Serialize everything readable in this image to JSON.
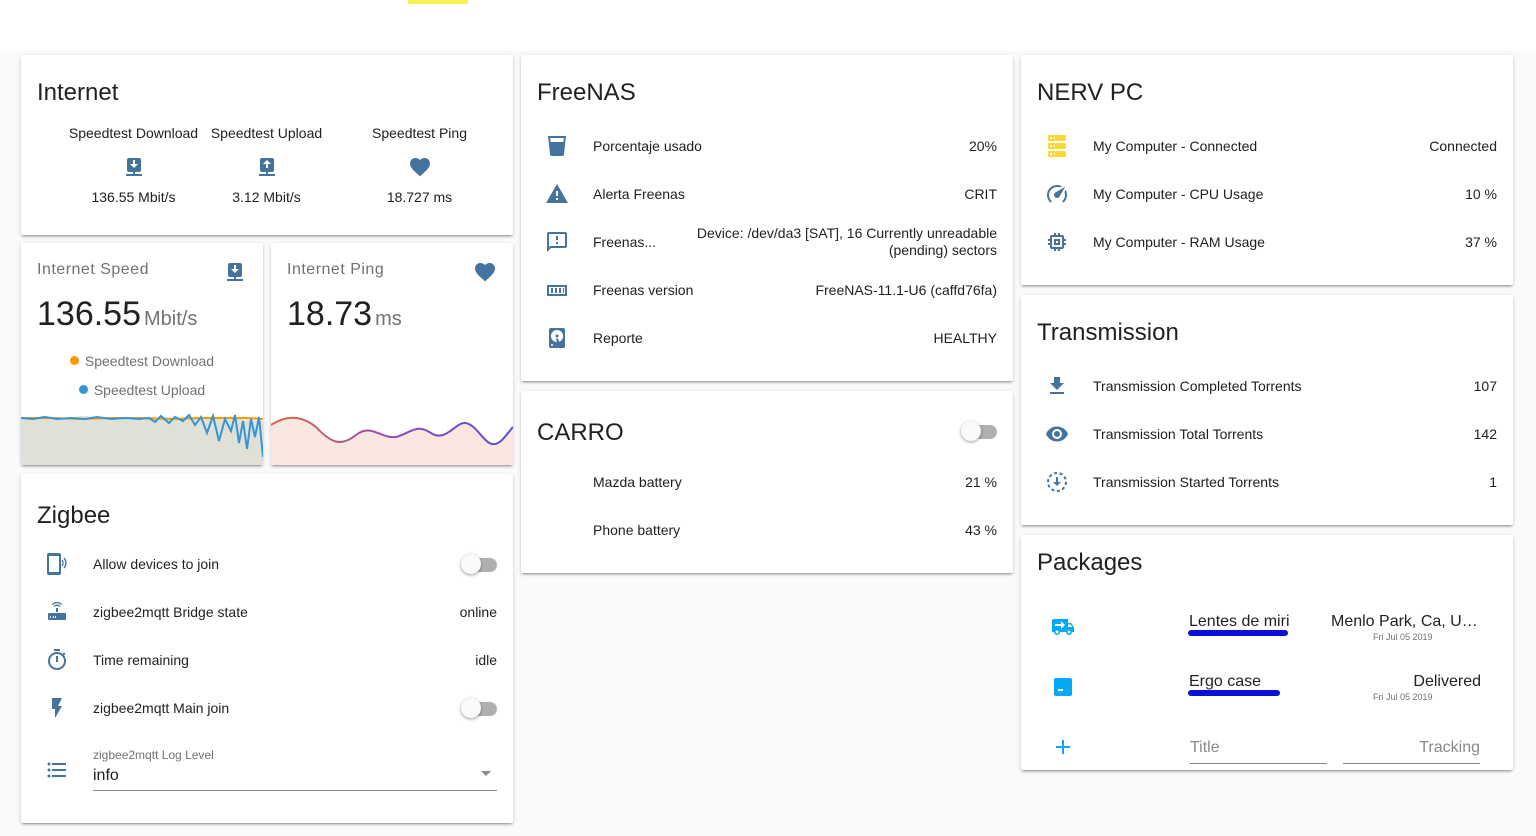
{
  "internet": {
    "title": "Internet",
    "entities": [
      {
        "name": "Speedtest Download",
        "icon": "download-network-icon",
        "value": "136.55 Mbit/s"
      },
      {
        "name": "Speedtest Upload",
        "icon": "upload-network-icon",
        "value": "3.12 Mbit/s"
      },
      {
        "name": "Speedtest Ping",
        "icon": "heart-icon",
        "value": "18.727 ms"
      }
    ]
  },
  "internet_speed": {
    "name": "Internet Speed",
    "value": "136.55",
    "unit": "Mbit/s",
    "icon": "download-network-icon",
    "legend": [
      {
        "name": "Speedtest Download",
        "color": "#ff9800"
      },
      {
        "name": "Speedtest Upload",
        "color": "#3295d8"
      }
    ]
  },
  "internet_ping": {
    "name": "Internet Ping",
    "value": "18.73",
    "unit": "ms",
    "icon": "heart-icon"
  },
  "freenas": {
    "title": "FreeNAS",
    "rows": [
      {
        "icon": "cup-icon",
        "name": "Porcentaje usado",
        "value": "20%"
      },
      {
        "icon": "alert-icon",
        "name": "Alerta Freenas",
        "value": "CRIT"
      },
      {
        "icon": "message-alert-icon",
        "name": "Freenas...",
        "value_line1": "Device: /dev/da3 [SAT], 16 Currently unreadable",
        "value_line2": "(pending) sectors"
      },
      {
        "icon": "memory-icon",
        "name": "Freenas version",
        "value": "FreeNAS-11.1-U6 (caffd76fa)"
      },
      {
        "icon": "harddisk-icon",
        "name": "Reporte",
        "value": "HEALTHY"
      }
    ]
  },
  "carro": {
    "title": "CARRO",
    "toggle_on": false,
    "rows": [
      {
        "name": "Mazda battery",
        "value": "21 %"
      },
      {
        "name": "Phone battery",
        "value": "43 %"
      }
    ]
  },
  "zigbee": {
    "title": "Zigbee",
    "rows": [
      {
        "icon": "cellphone-wireless-icon",
        "name": "Allow devices to join",
        "toggle_on": false
      },
      {
        "icon": "router-wireless-icon",
        "name": "zigbee2mqtt Bridge state",
        "value": "online"
      },
      {
        "icon": "timer-icon",
        "name": "Time remaining",
        "value": "idle"
      },
      {
        "icon": "flash-icon",
        "name": "zigbee2mqtt Main join",
        "toggle_on": false
      }
    ],
    "select": {
      "icon": "format-list-bulleted-icon",
      "label": "zigbee2mqtt Log Level",
      "value": "info"
    }
  },
  "nerv": {
    "title": "NERV PC",
    "rows": [
      {
        "icon": "server-icon",
        "name": "My Computer - Connected",
        "value": "Connected",
        "icon_color": "#fdd835"
      },
      {
        "icon": "speedometer-icon",
        "name": "My Computer - CPU Usage",
        "value": "10 %"
      },
      {
        "icon": "chip-icon",
        "name": "My Computer - RAM Usage",
        "value": "37 %"
      }
    ]
  },
  "transmission": {
    "title": "Transmission",
    "rows": [
      {
        "icon": "download-icon",
        "name": "Transmission Completed Torrents",
        "value": "107"
      },
      {
        "icon": "eye-icon",
        "name": "Transmission Total Torrents",
        "value": "142"
      },
      {
        "icon": "download-circle-dashed-icon",
        "name": "Transmission Started Torrents",
        "value": "1"
      }
    ]
  },
  "packages": {
    "title": "Packages",
    "items": [
      {
        "icon": "truck-delivery-icon",
        "title": "Lentes de miri",
        "status": "Menlo Park, Ca, United States",
        "date": "Fri Jul 05 2019"
      },
      {
        "icon": "package-icon",
        "title": "Ergo case",
        "status": "Delivered",
        "date": "Fri Jul 05 2019"
      }
    ],
    "add_icon": "plus-icon",
    "title_placeholder": "Title",
    "tracking_placeholder": "Tracking"
  },
  "colors": {
    "icon": "#44739e",
    "package_icon": "#03a9f4",
    "scribble": "#0a10d8",
    "download_series": "#ff9800",
    "upload_series": "#3295d8"
  }
}
